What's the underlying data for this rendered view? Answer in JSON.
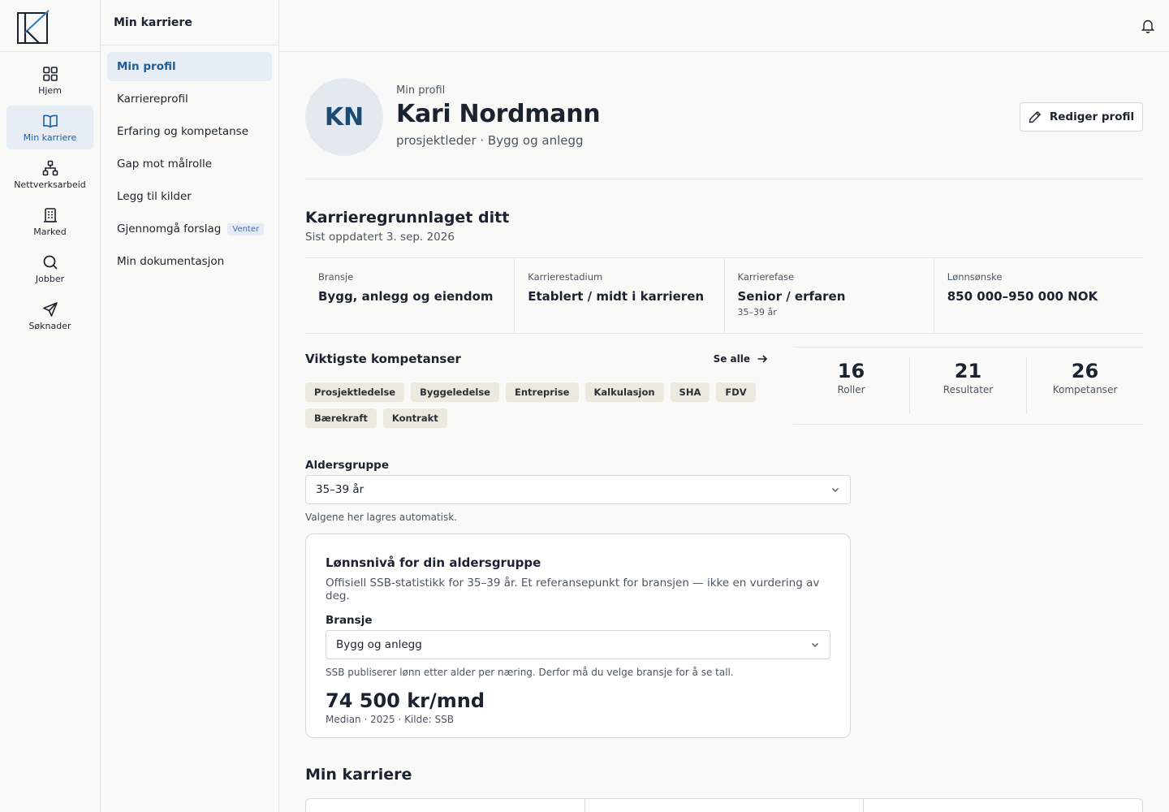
{
  "rail": {
    "items": [
      {
        "label": "Hjem",
        "icon": "grid-icon"
      },
      {
        "label": "Min karriere",
        "icon": "book-icon",
        "active": true
      },
      {
        "label": "Nettverksarbeid",
        "icon": "network-icon"
      },
      {
        "label": "Marked",
        "icon": "building-icon"
      },
      {
        "label": "Jobber",
        "icon": "search-icon"
      },
      {
        "label": "Søknader",
        "icon": "send-icon"
      }
    ]
  },
  "subnav": {
    "title": "Min karriere",
    "items": [
      {
        "label": "Min profil",
        "active": true
      },
      {
        "label": "Karriereprofil"
      },
      {
        "label": "Erfaring og kompetanse"
      },
      {
        "label": "Gap mot målrolle"
      },
      {
        "label": "Legg til kilder"
      },
      {
        "label": "Gjennomgå forslag",
        "badge": "Venter"
      },
      {
        "label": "Min dokumentasjon"
      }
    ]
  },
  "profile": {
    "initials": "KN",
    "eyebrow": "Min profil",
    "name": "Kari Nordmann",
    "role_line": "prosjektleder · Bygg og anlegg",
    "edit_label": "Rediger profil"
  },
  "foundation": {
    "title": "Karrieregrunnlaget ditt",
    "updated": "Sist oppdatert 3. sep. 2026",
    "facts": [
      {
        "label": "Bransje",
        "value": "Bygg, anlegg og eiendom",
        "sub": ""
      },
      {
        "label": "Karrierestadium",
        "value": "Etablert / midt i karrieren",
        "sub": ""
      },
      {
        "label": "Karrierefase",
        "value": "Senior / erfaren",
        "sub": "35–39 år"
      },
      {
        "label": "Lønnsønske",
        "value": "850 000–950 000 NOK",
        "sub": ""
      }
    ]
  },
  "competencies": {
    "title": "Viktigste kompetanser",
    "see_all": "Se alle",
    "chips": [
      "Prosjektledelse",
      "Byggeledelse",
      "Entreprise",
      "Kalkulasjon",
      "SHA",
      "FDV",
      "Bærekraft",
      "Kontrakt"
    ]
  },
  "stats": [
    {
      "value": "16",
      "label": "Roller"
    },
    {
      "value": "21",
      "label": "Resultater"
    },
    {
      "value": "26",
      "label": "Kompetanser"
    }
  ],
  "age_group": {
    "label": "Aldersgruppe",
    "value": "35–39 år",
    "hint": "Valgene her lagres automatisk."
  },
  "salary": {
    "title": "Lønnsnivå for din aldersgruppe",
    "desc": "Offisiell SSB-statistikk for 35–39 år. Et referansepunkt for bransjen — ikke en vurdering av deg.",
    "industry_label": "Bransje",
    "industry_value": "Bygg og anlegg",
    "hint": "SSB publiserer lønn etter alder per næring. Derfor må du velge bransje for å se tall.",
    "amount": "74 500 kr/mnd",
    "meta": "Median · 2025 · Kilde: SSB"
  },
  "career": {
    "title": "Min karriere"
  },
  "colors": {
    "accent": "#1f5d9a",
    "active_bg": "#e7edf5",
    "chip_bg": "#ede9e0",
    "text": "#1b2230"
  }
}
